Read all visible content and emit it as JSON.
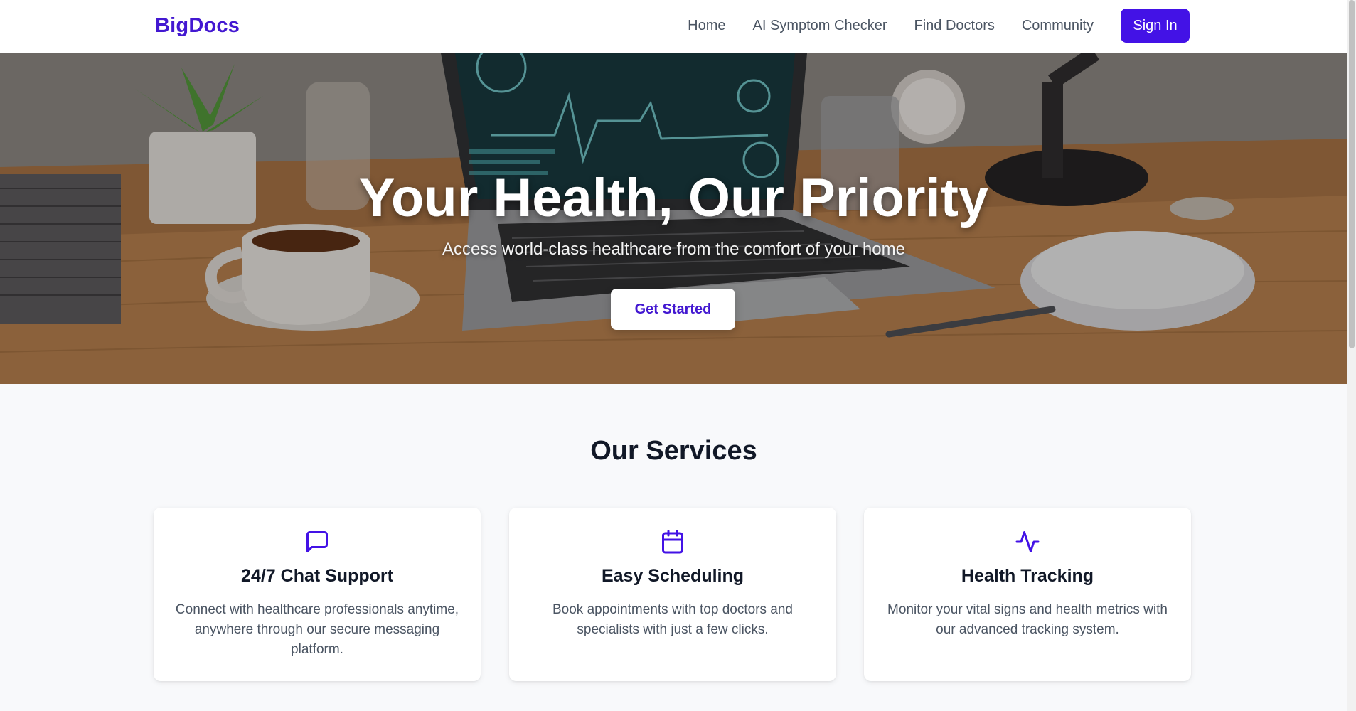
{
  "nav": {
    "brand": "BigDocs",
    "links": [
      "Home",
      "AI Symptom Checker",
      "Find Doctors",
      "Community"
    ],
    "signin": "Sign In"
  },
  "hero": {
    "title": "Your Health, Our Priority",
    "subtitle": "Access world-class healthcare from the comfort of your home",
    "cta": "Get Started"
  },
  "services": {
    "title": "Our Services",
    "cards": [
      {
        "icon": "message-square-icon",
        "title": "24/7 Chat Support",
        "description": "Connect with healthcare professionals anytime, anywhere through our secure messaging platform."
      },
      {
        "icon": "calendar-icon",
        "title": "Easy Scheduling",
        "description": "Book appointments with top doctors and specialists with just a few clicks."
      },
      {
        "icon": "activity-icon",
        "title": "Health Tracking",
        "description": "Monitor your vital signs and health metrics with our advanced tracking system."
      }
    ]
  },
  "colors": {
    "brand": "#4318d1",
    "primary_button": "#4312e6",
    "heading": "#111827",
    "body_text": "#4b5563"
  }
}
